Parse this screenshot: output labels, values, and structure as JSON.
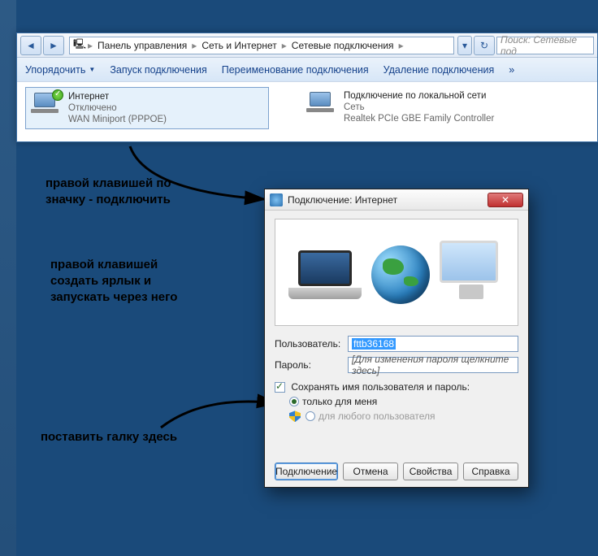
{
  "nav": {
    "crumbs": [
      "Панель управления",
      "Сеть и Интернет",
      "Сетевые подключения"
    ],
    "search_placeholder": "Поиск: Сетевые под"
  },
  "toolbar": {
    "items": [
      "Упорядочить",
      "Запуск подключения",
      "Переименование подключения",
      "Удаление подключения"
    ],
    "overflow": "»"
  },
  "connections": [
    {
      "name": "Интернет",
      "status": "Отключено",
      "device": "WAN Miniport (PPPOE)"
    },
    {
      "name": "Подключение по локальной сети",
      "status": "Сеть",
      "device": "Realtek PCIe GBE Family Controller"
    }
  ],
  "annotations": {
    "a1": "правой клавишей по\nзначку - подключить",
    "a2": "правой клавишей\nсоздать ярлык и\nзапускать через него",
    "a3": "поставить галку здесь"
  },
  "dialog": {
    "title": "Подключение: Интернет",
    "close": "✕",
    "user_label": "Пользователь:",
    "user_value": "fttb36168",
    "pass_label": "Пароль:",
    "pass_placeholder": "[Для изменения пароля щелкните здесь]",
    "save_label": "Сохранять имя пользователя и пароль:",
    "opt_me": "только для меня",
    "opt_any": "для любого пользователя",
    "buttons": {
      "connect": "Подключение",
      "cancel": "Отмена",
      "props": "Свойства",
      "help": "Справка"
    }
  }
}
